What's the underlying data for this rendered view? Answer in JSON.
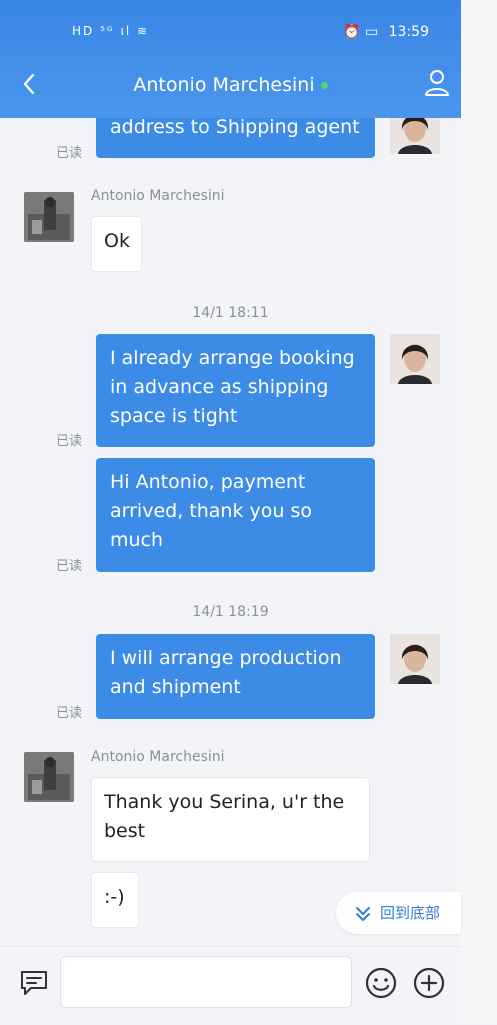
{
  "status_bar": {
    "left_indicators": "HD ⁵ᴳ ıl ≋",
    "time": "13:59"
  },
  "header": {
    "title": "Antonio Marchesini"
  },
  "messages": {
    "m0_text": "address to Shipping agent",
    "m0_read": "已读",
    "m1_sender": "Antonio Marchesini",
    "m1_text": "Ok",
    "ts1": "14/1 18:11",
    "m2_text": "I already arrange booking in advance as shipping space is tight",
    "m2_read": "已读",
    "m3_text": "Hi Antonio, payment arrived, thank you so much",
    "m3_read": "已读",
    "ts2": "14/1 18:19",
    "m4_text": "I will arrange production and shipment",
    "m4_read": "已读",
    "m5_sender": "Antonio Marchesini",
    "m5_text": "Thank you Serina, u'r the best",
    "m6_text": ":-)"
  },
  "scroll_to_bottom": {
    "label": "回到底部"
  },
  "colors": {
    "header": "#3a86e6",
    "bubble_out": "#3c8be6",
    "accent": "#2f7be0"
  },
  "icons": [
    "chevron-left-icon",
    "user-profile-icon",
    "message-icon",
    "emoji-icon",
    "plus-circle-icon",
    "chevron-double-down-icon"
  ]
}
